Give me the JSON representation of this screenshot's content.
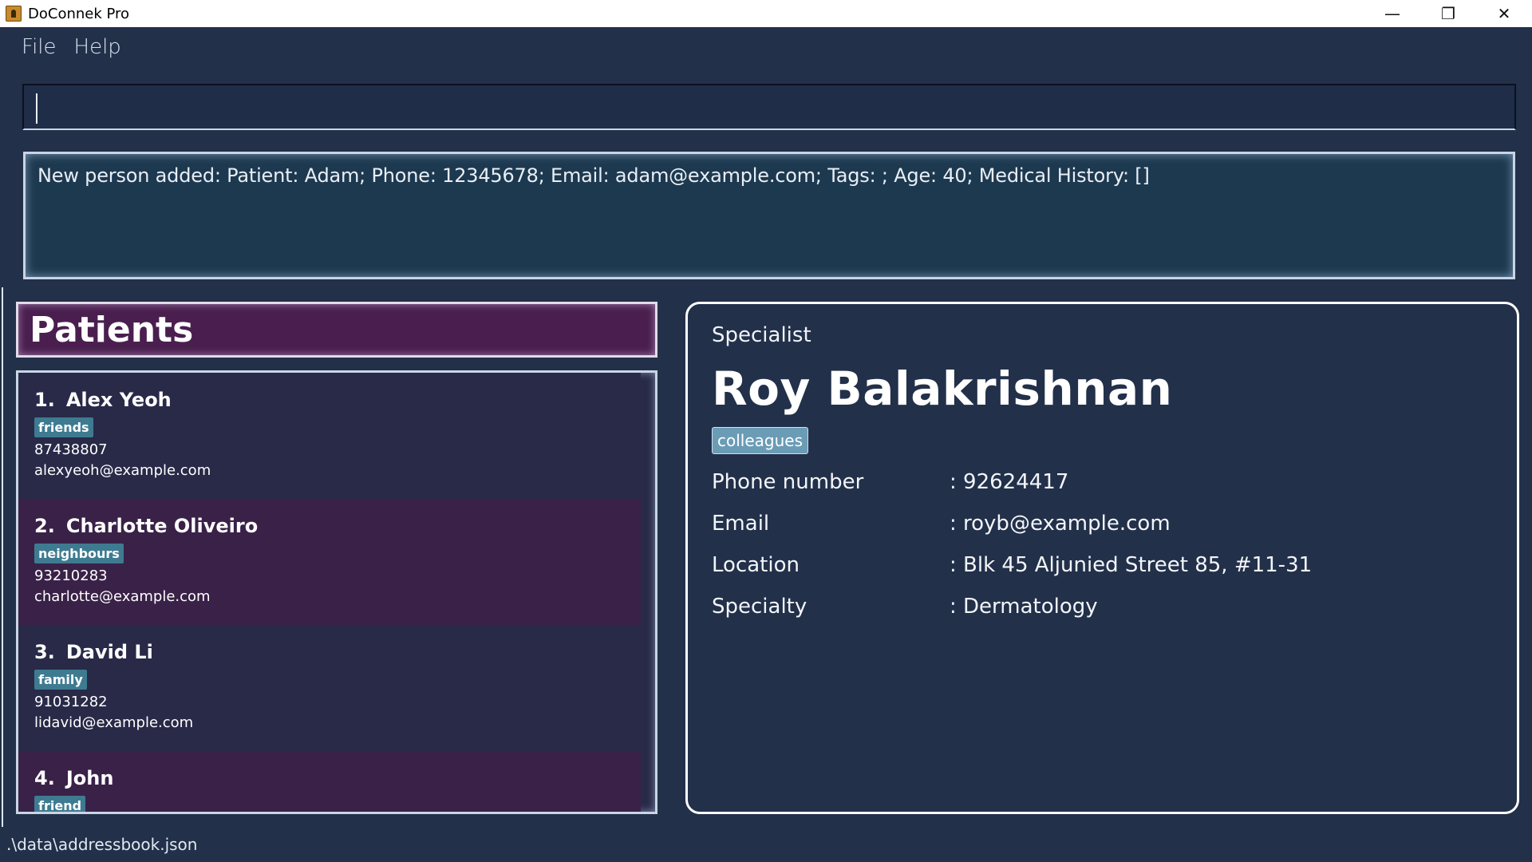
{
  "window": {
    "title": "DoConnek Pro",
    "controls": {
      "minimize": "—",
      "maximize": "❐",
      "close": "✕"
    }
  },
  "menu": [
    "File",
    "Help"
  ],
  "command": {
    "value": "",
    "placeholder": ""
  },
  "result": {
    "text": "New person added: Patient: Adam; Phone: 12345678; Email: adam@example.com; Tags: ; Age: 40; Medical History: []"
  },
  "patients_panel": {
    "title": "Patients",
    "items": [
      {
        "index": "1.",
        "name": "Alex Yeoh",
        "tag": "friends",
        "phone": "87438807",
        "email": "alexyeoh@example.com"
      },
      {
        "index": "2.",
        "name": "Charlotte Oliveiro",
        "tag": "neighbours",
        "phone": "93210283",
        "email": "charlotte@example.com"
      },
      {
        "index": "3.",
        "name": "David Li",
        "tag": "family",
        "phone": "91031282",
        "email": "lidavid@example.com"
      },
      {
        "index": "4.",
        "name": "John",
        "tag": "friend",
        "phone": "",
        "email": ""
      }
    ]
  },
  "detail": {
    "role": "Specialist",
    "name": "Roy Balakrishnan",
    "tag": "colleagues",
    "fields": [
      {
        "label": "Phone number",
        "value": ": 92624417"
      },
      {
        "label": "Email",
        "value": ": royb@example.com"
      },
      {
        "label": "Location",
        "value": ": Blk 45 Aljunied Street 85, #11-31"
      },
      {
        "label": "Specialty",
        "value": ": Dermatology"
      }
    ]
  },
  "status": {
    "path": ".\\data\\addressbook.json"
  },
  "colors": {
    "background": "#22304a",
    "header_purple": "#4a1f4f",
    "tag_teal": "#3e7b91",
    "result_bg": "#1d3950"
  }
}
